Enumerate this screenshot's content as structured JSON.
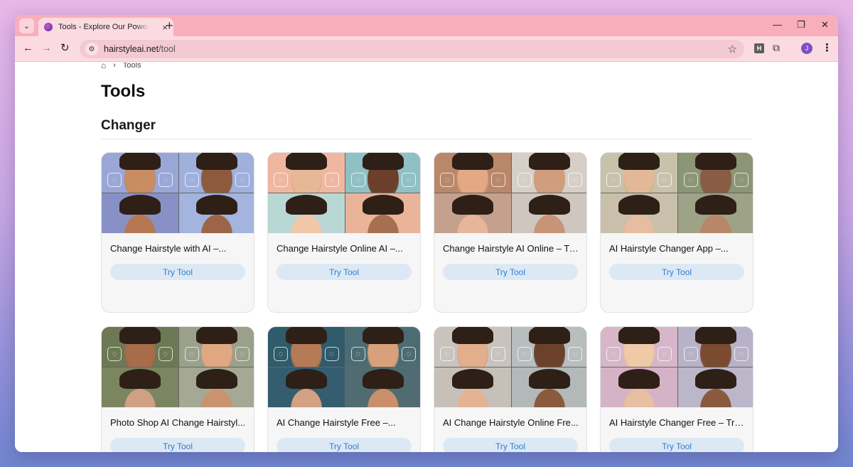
{
  "browser": {
    "tab_title": "Tools - Explore Our Powerful To",
    "tab_close": "×",
    "new_tab": "+",
    "url_host": "hairstyleai.net",
    "url_path": "/tool",
    "ext_letter": "H",
    "profile_initial": "J",
    "controls": {
      "minimize": "—",
      "restore": "❐",
      "close": "✕"
    }
  },
  "breadcrumb": {
    "home_icon": "home-icon",
    "separator": "›",
    "current": "Tools"
  },
  "page": {
    "title": "Tools"
  },
  "section": {
    "title": "Changer"
  },
  "cards": [
    {
      "name": "Change Hairstyle with AI –...",
      "button": "Try Tool",
      "bg": [
        "#9aa6d6",
        "#9fb0dc",
        "#8791c6",
        "#a3b4de"
      ],
      "skin": [
        "#c98d62",
        "#8d5a3e",
        "#b57853",
        "#9c6547"
      ]
    },
    {
      "name": "Change Hairstyle Online AI –...",
      "button": "Try Tool",
      "bg": [
        "#f0b7a0",
        "#8fc1c4",
        "#b9d7d4",
        "#e9b49a"
      ],
      "skin": [
        "#e6b895",
        "#6b3f2a",
        "#f0c8a8",
        "#a66f4f"
      ]
    },
    {
      "name": "Change Hairstyle AI Online – Tr...",
      "button": "Try Tool",
      "bg": [
        "#b98769",
        "#d5cfc8",
        "#c4a18c",
        "#cfc7bf"
      ],
      "skin": [
        "#e3a985",
        "#d09e7c",
        "#e6b59a",
        "#c89477"
      ]
    },
    {
      "name": "AI Hairstyle Changer App –...",
      "button": "Try Tool",
      "bg": [
        "#c8c2aa",
        "#8c9575",
        "#c9c0ab",
        "#9ea287"
      ],
      "skin": [
        "#e3b898",
        "#8a5c43",
        "#e6bd9e",
        "#b8876a"
      ]
    },
    {
      "name": "Photo Shop AI Change Hairstyl...",
      "button": "Try Tool",
      "bg": [
        "#6d7854",
        "#9aa08a",
        "#7b8560",
        "#a5a994"
      ],
      "skin": [
        "#a76c4a",
        "#e0a882",
        "#d0a085",
        "#c8946f"
      ]
    },
    {
      "name": "AI Change Hairstyle Free –...",
      "button": "Try Tool",
      "bg": [
        "#2f5b6b",
        "#4c6c74",
        "#345e6f",
        "#506c72"
      ],
      "skin": [
        "#b77a56",
        "#d9a07c",
        "#d2a283",
        "#c98f6b"
      ]
    },
    {
      "name": "AI Change Hairstyle Online Fre...",
      "button": "Try Tool",
      "bg": [
        "#c9c3be",
        "#b8bdbe",
        "#c7c0b9",
        "#b3b8b9"
      ],
      "skin": [
        "#e2ae8c",
        "#6b412b",
        "#e3b394",
        "#8b5a3e"
      ]
    },
    {
      "name": "AI Hairstyle Changer Free – Try...",
      "button": "Try Tool",
      "bg": [
        "#d7b6c9",
        "#b7b2c7",
        "#d4b3c6",
        "#bcb6ca"
      ],
      "skin": [
        "#efc9a8",
        "#7a4a31",
        "#e8bfa1",
        "#8a5a3e"
      ]
    }
  ]
}
